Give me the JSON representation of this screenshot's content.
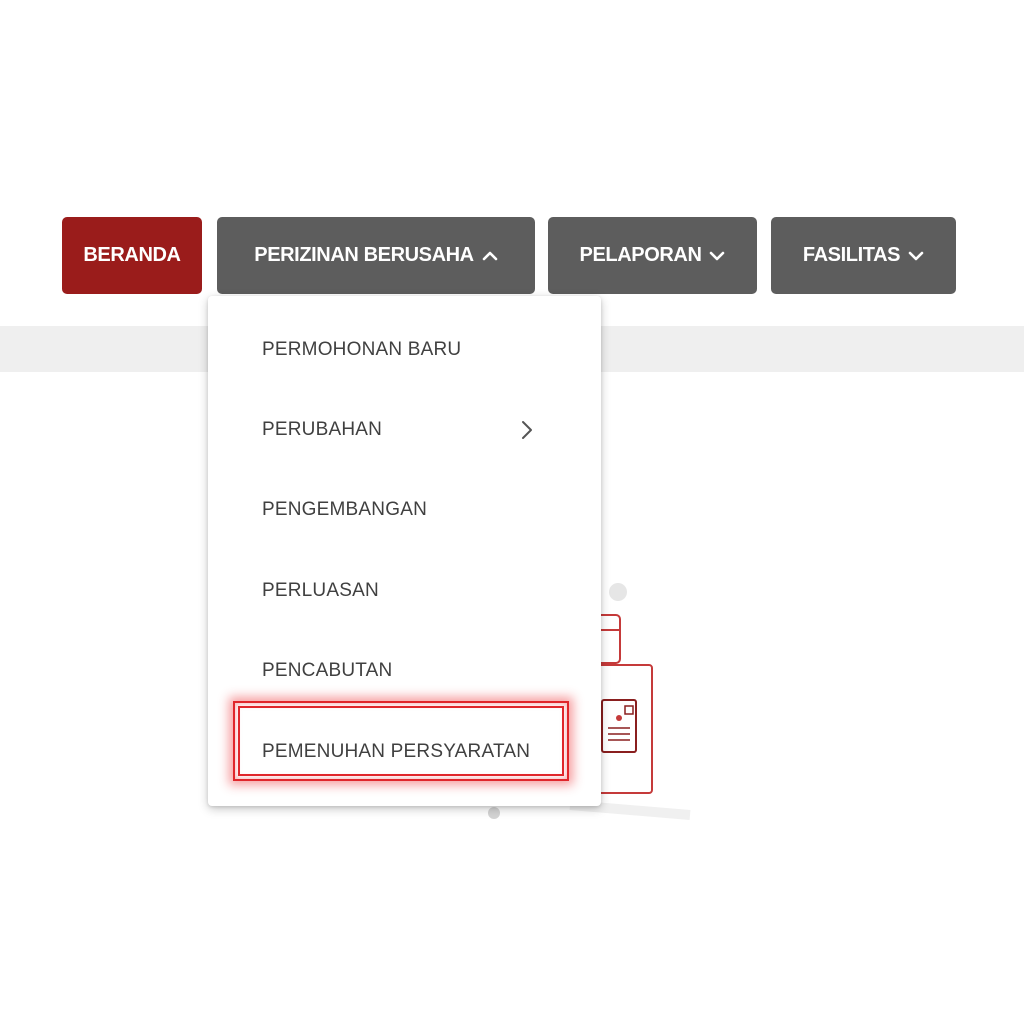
{
  "nav": {
    "beranda": "BERANDA",
    "perizinan": "PERIZINAN BERUSAHA",
    "pelaporan": "PELAPORAN",
    "fasilitas": "FASILITAS"
  },
  "dropdown": {
    "items": [
      {
        "label": "PERMOHONAN BARU"
      },
      {
        "label": "PERUBAHAN",
        "has_submenu": true
      },
      {
        "label": "PENGEMBANGAN"
      },
      {
        "label": "PERLUASAN"
      },
      {
        "label": "PENCABUTAN"
      },
      {
        "label": "PEMENUHAN PERSYARATAN",
        "highlighted": true
      }
    ]
  },
  "icons": {
    "chevron_up": "chevron-up-icon",
    "chevron_down": "chevron-down-icon",
    "chevron_right": "chevron-right-icon"
  },
  "colors": {
    "active_nav": "#9a1c1b",
    "nav": "#5d5d5d",
    "highlight": "#e0262b"
  }
}
